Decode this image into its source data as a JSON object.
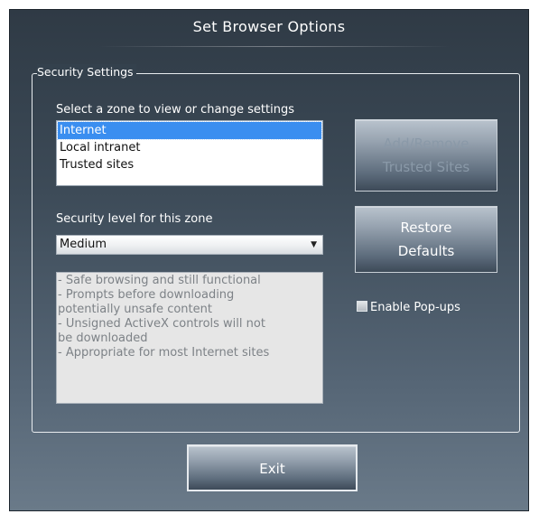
{
  "window": {
    "title": "Set Browser Options"
  },
  "security": {
    "group_label": "Security Settings",
    "zone_prompt": "Select a zone to view or change settings",
    "zones": [
      {
        "label": "Internet",
        "selected": true
      },
      {
        "label": "Local intranet",
        "selected": false
      },
      {
        "label": "Trusted sites",
        "selected": false
      }
    ],
    "level_label": "Security level for this zone",
    "level_value": "Medium",
    "description_lines": [
      "- Safe browsing and still functional",
      "- Prompts before downloading",
      "potentially unsafe content",
      "- Unsigned ActiveX controls will not",
      "be downloaded",
      "- Appropriate for most Internet sites"
    ]
  },
  "buttons": {
    "add_remove_line1": "Add/Remove",
    "add_remove_line2": "Trusted Sites",
    "add_remove_enabled": false,
    "restore_line1": "Restore",
    "restore_line2": "Defaults",
    "exit": "Exit"
  },
  "popups": {
    "label": "Enable Pop-ups",
    "checked": false
  },
  "colors": {
    "selection": "#3a8ef0",
    "dialog_top": "#2f3a45",
    "dialog_bottom": "#6a7a89"
  },
  "icons": {
    "dropdown": "chevron-down-icon"
  }
}
